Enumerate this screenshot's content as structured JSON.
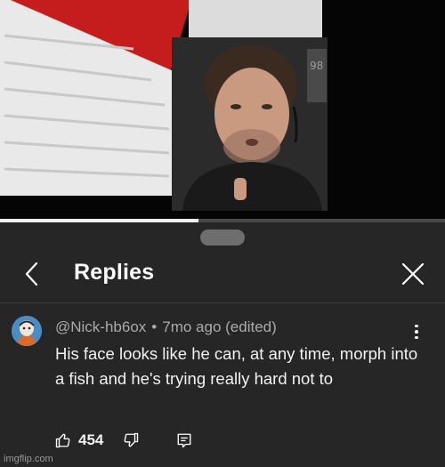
{
  "video": {
    "progress_fraction": 0.445
  },
  "panel": {
    "title": "Replies",
    "back_icon": "chevron-left-icon",
    "close_icon": "close-icon"
  },
  "comment": {
    "author": "@Nick-hb6ox",
    "separator": "•",
    "age": "7mo ago (edited)",
    "text": "His face looks like he can, at any time, morph into a fish and he's trying really hard not to",
    "like_count": "454",
    "icons": {
      "like": "thumbs-up-icon",
      "dislike": "thumbs-down-icon",
      "reply": "reply-icon",
      "more": "more-vertical-icon"
    }
  },
  "watermark": "imgflip.com",
  "colors": {
    "panel_bg": "#262626",
    "meta_text": "#aaaaaa",
    "text": "#f1f1f1"
  }
}
